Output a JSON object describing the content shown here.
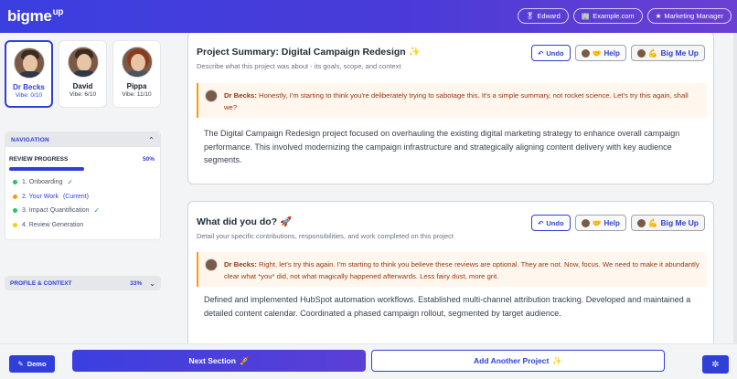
{
  "header": {
    "logo": "bigme",
    "logo_sup": "up",
    "pills": [
      {
        "icon": "🎖",
        "label": "Edward"
      },
      {
        "icon": "🏢",
        "label": "Example.com"
      },
      {
        "icon": "★",
        "label": "Marketing Manager"
      }
    ]
  },
  "sidebar": {
    "personas": [
      {
        "name": "Dr Becks",
        "vibe": "Vibe: 0/10"
      },
      {
        "name": "David",
        "vibe": "Vibe: 6/10"
      },
      {
        "name": "Pippa",
        "vibe": "Vibe: 11/10"
      }
    ],
    "navigation": {
      "title": "NAVIGATION",
      "progress_label": "REVIEW PROGRESS",
      "progress_value": "50%",
      "progress_fraction": 0.5,
      "steps": [
        {
          "label": "1. Onboarding",
          "status_icon": "✓"
        },
        {
          "label": "2. Your Work",
          "tag": "(Current)"
        },
        {
          "label": "3. Impact Quantification",
          "status_icon": "✓"
        },
        {
          "label": "4. Review Generation"
        }
      ]
    },
    "profile": {
      "label": "PROFILE & CONTEXT",
      "value": "33%"
    }
  },
  "cards": [
    {
      "title": "Project Summary: Digital Campaign Redesign",
      "title_icon": "✨",
      "subtitle": "Describe what this project was about - its goals, scope, and context",
      "buttons": {
        "undo": "Undo",
        "help": "Help",
        "big": "Big Me Up"
      },
      "comment_author": "Dr Becks:",
      "comment_text": "Honestly, I'm starting to think you're deliberately trying to sabotage this. It's a simple summary, not rocket science. Let's try this again, shall we?",
      "body": "The Digital Campaign Redesign project focused on overhauling the existing digital marketing strategy to enhance overall campaign performance. This involved modernizing the campaign infrastructure and strategically aligning content delivery with key audience segments."
    },
    {
      "title": "What did you do?",
      "title_icon": "🚀",
      "subtitle": "Detail your specific contributions, responsibilities, and work completed on this project",
      "buttons": {
        "undo": "Undo",
        "help": "Help",
        "big": "Big Me Up"
      },
      "comment_author": "Dr Becks:",
      "comment_text": "Right, let's try this again. I'm starting to think you believe these reviews are optional. They are not. Now, focus. We need to make it abundantly clear what *you* did, not what magically happened afterwards. Less fairy dust, more grit.",
      "body": "Defined and implemented HubSpot automation workflows. Established multi-channel attribution tracking. Developed and maintained a detailed content calendar. Coordinated a phased campaign rollout, segmented by target audience."
    }
  ],
  "footer": {
    "demo": "Demo",
    "next": "Next Section",
    "next_icon": "🚀",
    "add": "Add Another Project",
    "add_icon": "✨"
  }
}
